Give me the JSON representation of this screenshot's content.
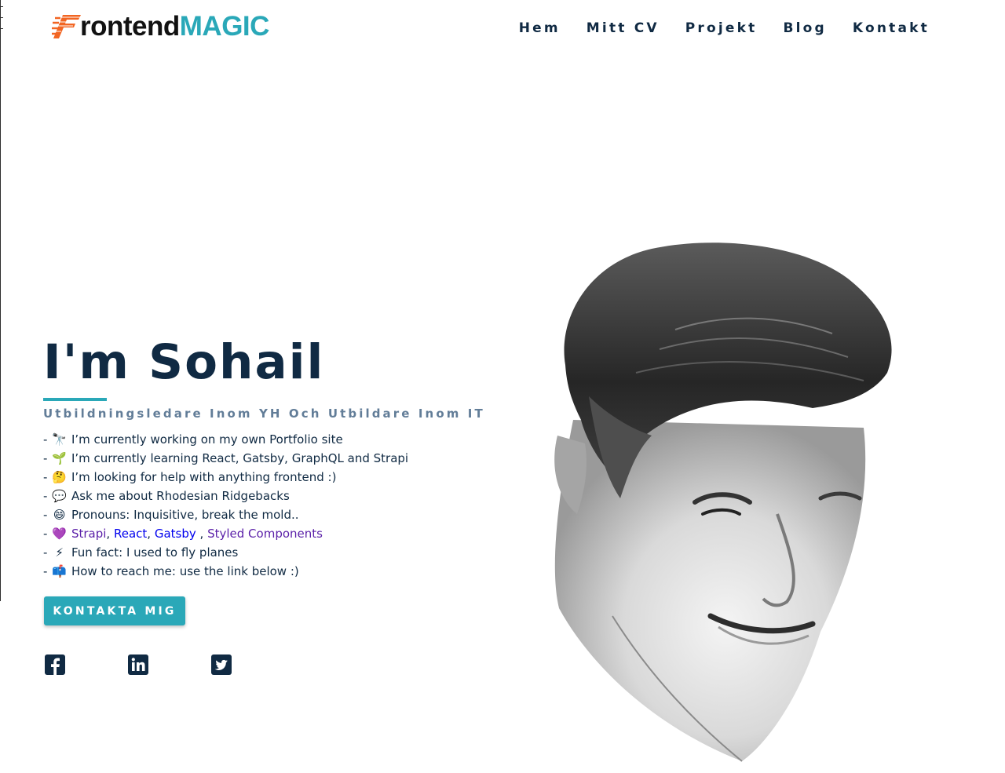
{
  "brand": {
    "logo_part1": "rontend",
    "logo_part2": "MAGIC",
    "accent_color": "#2aa8b8",
    "logo_mark_color": "#f26522"
  },
  "nav": {
    "items": [
      {
        "label": "Hem"
      },
      {
        "label": "Mitt CV"
      },
      {
        "label": "Projekt"
      },
      {
        "label": "Blog"
      },
      {
        "label": "Kontakt"
      }
    ]
  },
  "hero": {
    "title": "I'm Sohail",
    "subtitle": "Utbildningsledare Inom YH Och Utbildare Inom IT",
    "facts": [
      {
        "prefix": "- ",
        "emoji": "🔭",
        "text": " I’m currently working on my own Portfolio site"
      },
      {
        "prefix": "- ",
        "emoji": "🌱",
        "text": " I’m currently learning React, Gatsby, GraphQL and Strapi"
      },
      {
        "prefix": "- ",
        "emoji": "🤔",
        "text": " I’m looking for help with anything frontend :)"
      },
      {
        "prefix": "- ",
        "emoji": "💬",
        "text": " Ask me about Rhodesian Ridgebacks"
      },
      {
        "prefix": "- ",
        "emoji": "😄",
        "text": " Pronouns: Inquisitive, break the mold.."
      },
      {
        "prefix": "- ",
        "emoji": "💜",
        "links": [
          "Strapi",
          "React",
          "Gatsby",
          "Styled Components"
        ],
        "sep_comma": ",",
        "sep_space_comma": " , "
      },
      {
        "prefix": "- ",
        "emoji": "⚡",
        "text": " Fun fact: I used to fly planes"
      },
      {
        "prefix": "- ",
        "emoji": "📫",
        "text": " How to reach me: use the link below :)"
      }
    ],
    "cta_label": "KONTAKTA MIG"
  },
  "socials": [
    {
      "icon": "facebook-icon"
    },
    {
      "icon": "linkedin-icon"
    },
    {
      "icon": "twitter-icon"
    }
  ],
  "portrait": {
    "icon": "portrait-photo"
  }
}
